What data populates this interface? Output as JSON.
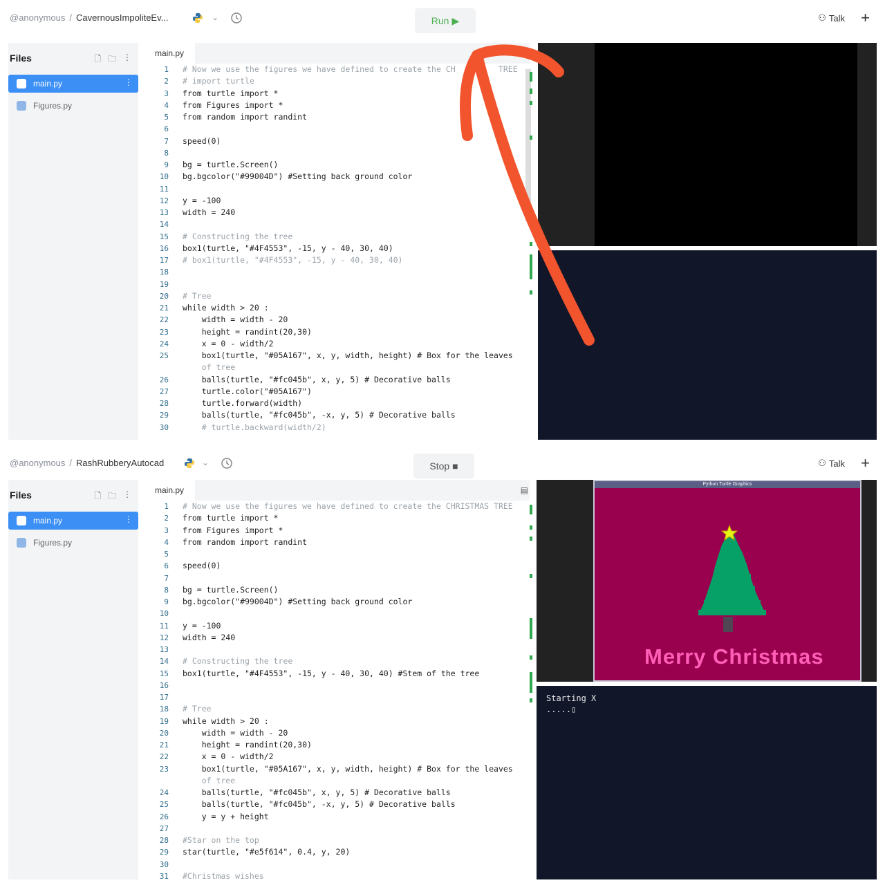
{
  "shot1": {
    "breadcrumb": {
      "user": "@anonymous",
      "separator": "/",
      "project": "CavernousImpoliteEv..."
    },
    "run_label": "Run",
    "talk_label": "Talk",
    "plus_label": "+",
    "sidebar": {
      "title": "Files",
      "files": [
        "main.py",
        "Figures.py"
      ]
    },
    "tab_label": "main.py",
    "code": [
      {
        "n": "1",
        "t": "# Now we use the figures we have defined to create the CH         TREE",
        "c": true
      },
      {
        "n": "2",
        "t": "# import turtle",
        "c": true
      },
      {
        "n": "3",
        "t": "from turtle import *",
        "c": false
      },
      {
        "n": "4",
        "t": "from Figures import *",
        "c": false
      },
      {
        "n": "5",
        "t": "from random import randint",
        "c": false
      },
      {
        "n": "6",
        "t": "",
        "c": false
      },
      {
        "n": "7",
        "t": "speed(0)",
        "c": false
      },
      {
        "n": "8",
        "t": "",
        "c": false
      },
      {
        "n": "9",
        "t": "bg = turtle.Screen()",
        "c": false
      },
      {
        "n": "10",
        "t": "bg.bgcolor(\"#99004D\") #Setting back ground color",
        "c": false
      },
      {
        "n": "11",
        "t": "",
        "c": false
      },
      {
        "n": "12",
        "t": "y = -100",
        "c": false
      },
      {
        "n": "13",
        "t": "width = 240",
        "c": false
      },
      {
        "n": "14",
        "t": "",
        "c": false
      },
      {
        "n": "15",
        "t": "# Constructing the tree",
        "c": true
      },
      {
        "n": "16",
        "t": "box1(turtle, \"#4F4553\", -15, y - 40, 30, 40)",
        "c": false
      },
      {
        "n": "17",
        "t": "# box1(turtle, \"#4F4553\", -15, y - 40, 30, 40)",
        "c": true
      },
      {
        "n": "18",
        "t": "",
        "c": false
      },
      {
        "n": "19",
        "t": "",
        "c": false
      },
      {
        "n": "20",
        "t": "# Tree",
        "c": true
      },
      {
        "n": "21",
        "t": "while width > 20 :",
        "c": false
      },
      {
        "n": "22",
        "t": "    width = width - 20",
        "c": false
      },
      {
        "n": "23",
        "t": "    height = randint(20,30)",
        "c": false
      },
      {
        "n": "24",
        "t": "    x = 0 - width/2",
        "c": false
      },
      {
        "n": "25",
        "t": "    box1(turtle, \"#05A167\", x, y, width, height) # Box for the leaves",
        "c": false
      },
      {
        "n": "",
        "t": "    of tree",
        "c": true
      },
      {
        "n": "26",
        "t": "    balls(turtle, \"#fc045b\", x, y, 5) # Decorative balls",
        "c": false
      },
      {
        "n": "27",
        "t": "    turtle.color(\"#05A167\")",
        "c": false
      },
      {
        "n": "28",
        "t": "    turtle.forward(width)",
        "c": false
      },
      {
        "n": "29",
        "t": "    balls(turtle, \"#fc045b\", -x, y, 5) # Decorative balls",
        "c": false
      },
      {
        "n": "30",
        "t": "    # turtle.backward(width/2)",
        "c": true
      }
    ]
  },
  "shot2": {
    "breadcrumb": {
      "user": "@anonymous",
      "separator": "/",
      "project": "RashRubberyAutocad"
    },
    "stop_label": "Stop",
    "talk_label": "Talk",
    "plus_label": "+",
    "sidebar": {
      "title": "Files",
      "files": [
        "main.py",
        "Figures.py"
      ]
    },
    "tab_label": "main.py",
    "code": [
      {
        "n": "1",
        "t": "# Now we use the figures we have defined to create the CHRISTMAS TREE",
        "c": true
      },
      {
        "n": "2",
        "t": "from turtle import *",
        "c": false
      },
      {
        "n": "3",
        "t": "from Figures import *",
        "c": false
      },
      {
        "n": "4",
        "t": "from random import randint",
        "c": false
      },
      {
        "n": "5",
        "t": "",
        "c": false
      },
      {
        "n": "6",
        "t": "speed(0)",
        "c": false
      },
      {
        "n": "7",
        "t": "",
        "c": false
      },
      {
        "n": "8",
        "t": "bg = turtle.Screen()",
        "c": false
      },
      {
        "n": "9",
        "t": "bg.bgcolor(\"#99004D\") #Setting back ground color",
        "c": false
      },
      {
        "n": "10",
        "t": "",
        "c": false
      },
      {
        "n": "11",
        "t": "y = -100",
        "c": false
      },
      {
        "n": "12",
        "t": "width = 240",
        "c": false
      },
      {
        "n": "13",
        "t": "",
        "c": false
      },
      {
        "n": "14",
        "t": "# Constructing the tree",
        "c": true
      },
      {
        "n": "15",
        "t": "box1(turtle, \"#4F4553\", -15, y - 40, 30, 40) #Stem of the tree",
        "c": false
      },
      {
        "n": "16",
        "t": "",
        "c": false
      },
      {
        "n": "17",
        "t": "",
        "c": false
      },
      {
        "n": "18",
        "t": "# Tree",
        "c": true
      },
      {
        "n": "19",
        "t": "while width > 20 :",
        "c": false
      },
      {
        "n": "20",
        "t": "    width = width - 20",
        "c": false
      },
      {
        "n": "21",
        "t": "    height = randint(20,30)",
        "c": false
      },
      {
        "n": "22",
        "t": "    x = 0 - width/2",
        "c": false
      },
      {
        "n": "23",
        "t": "    box1(turtle, \"#05A167\", x, y, width, height) # Box for the leaves",
        "c": false
      },
      {
        "n": "",
        "t": "    of tree",
        "c": true
      },
      {
        "n": "24",
        "t": "    balls(turtle, \"#fc045b\", x, y, 5) # Decorative balls",
        "c": false
      },
      {
        "n": "25",
        "t": "    balls(turtle, \"#fc045b\", -x, y, 5) # Decorative balls",
        "c": false
      },
      {
        "n": "26",
        "t": "    y = y + height",
        "c": false
      },
      {
        "n": "27",
        "t": "",
        "c": false
      },
      {
        "n": "28",
        "t": "#Star on the top",
        "c": true
      },
      {
        "n": "29",
        "t": "star(turtle, \"#e5f614\", 0.4, y, 20)",
        "c": false
      },
      {
        "n": "30",
        "t": "",
        "c": false
      },
      {
        "n": "31",
        "t": "#Christmas wishes",
        "c": true
      }
    ],
    "turtle_window_title": "Python Turtle Graphics",
    "merry_text": "Merry Christmas",
    "console_lines": "Starting X\n.....▯"
  },
  "colors": {
    "accent": "#3b8ff5",
    "run_green": "#4caf50",
    "canvas_bg": "#99004d",
    "tree": "#05a167",
    "star": "#e5f614",
    "arrow": "#f2542d",
    "console_bg": "#111629"
  }
}
